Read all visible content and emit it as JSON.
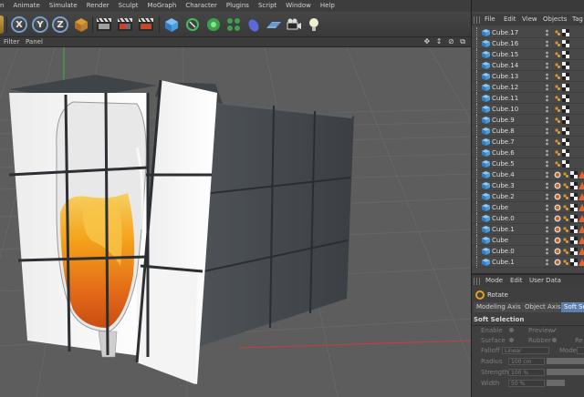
{
  "app": {
    "menu": [
      "n",
      "Animate",
      "Simulate",
      "Render",
      "Sculpt",
      "MoGraph",
      "Character",
      "Plugins",
      "Script",
      "Window",
      "Help"
    ]
  },
  "toolbar": {
    "axis_x": "X",
    "axis_y": "Y",
    "axis_z": "Z"
  },
  "viewport": {
    "menu": [
      "Filter",
      "Panel"
    ],
    "nav_icons": "✥ ↕ ⊘ ⧉"
  },
  "objects_panel": {
    "menu": [
      "File",
      "Edit",
      "View",
      "Objects",
      "Tag"
    ],
    "items": [
      {
        "name": "Cube.17",
        "tags": 1
      },
      {
        "name": "Cube.16",
        "tags": 1
      },
      {
        "name": "Cube.15",
        "tags": 1
      },
      {
        "name": "Cube.14",
        "tags": 1
      },
      {
        "name": "Cube.13",
        "tags": 1
      },
      {
        "name": "Cube.12",
        "tags": 1
      },
      {
        "name": "Cube.11",
        "tags": 1
      },
      {
        "name": "Cube.10",
        "tags": 1
      },
      {
        "name": "Cube.9",
        "tags": 1
      },
      {
        "name": "Cube.8",
        "tags": 1
      },
      {
        "name": "Cube.7",
        "tags": 1
      },
      {
        "name": "Cube.6",
        "tags": 1
      },
      {
        "name": "Cube.5",
        "tags": 1
      },
      {
        "name": "Cube.4",
        "tags": 3
      },
      {
        "name": "Cube.3",
        "tags": 3
      },
      {
        "name": "Cube.2",
        "tags": 3
      },
      {
        "name": "Cube",
        "tags": 3
      },
      {
        "name": "Cube.0",
        "tags": 3
      },
      {
        "name": "Cube.1",
        "tags": 3
      },
      {
        "name": "Cube",
        "tags": 3
      },
      {
        "name": "Cube.0",
        "tags": 3
      },
      {
        "name": "Cube.1",
        "tags": 3
      }
    ]
  },
  "attributes": {
    "menu": [
      "Mode",
      "Edit",
      "User Data"
    ],
    "tool_name": "Rotate",
    "tabs": [
      "Modeling Axis",
      "Object Axis",
      "Soft Se"
    ],
    "active_tab": 2,
    "section": "Soft Selection",
    "enable_label": "Enable",
    "preview_label": "Preview",
    "preview_check": "✓",
    "surface_label": "Surface",
    "rubber_label": "Rubber",
    "re_label": "Re",
    "falloff_label": "Falloff",
    "falloff_value": "Linear",
    "mode_label": "Mode",
    "radius_label": "Radius",
    "radius_value": "100 cm",
    "strength_label": "Strength",
    "strength_value": "100 %",
    "width_label": "Width",
    "width_value": "50 %"
  },
  "colors": {
    "accent": "#5b7fae",
    "panel_bg": "#464646",
    "viewport_bg": "#5d5d5d",
    "axis_x": "#d04040",
    "axis_y": "#40b040"
  }
}
